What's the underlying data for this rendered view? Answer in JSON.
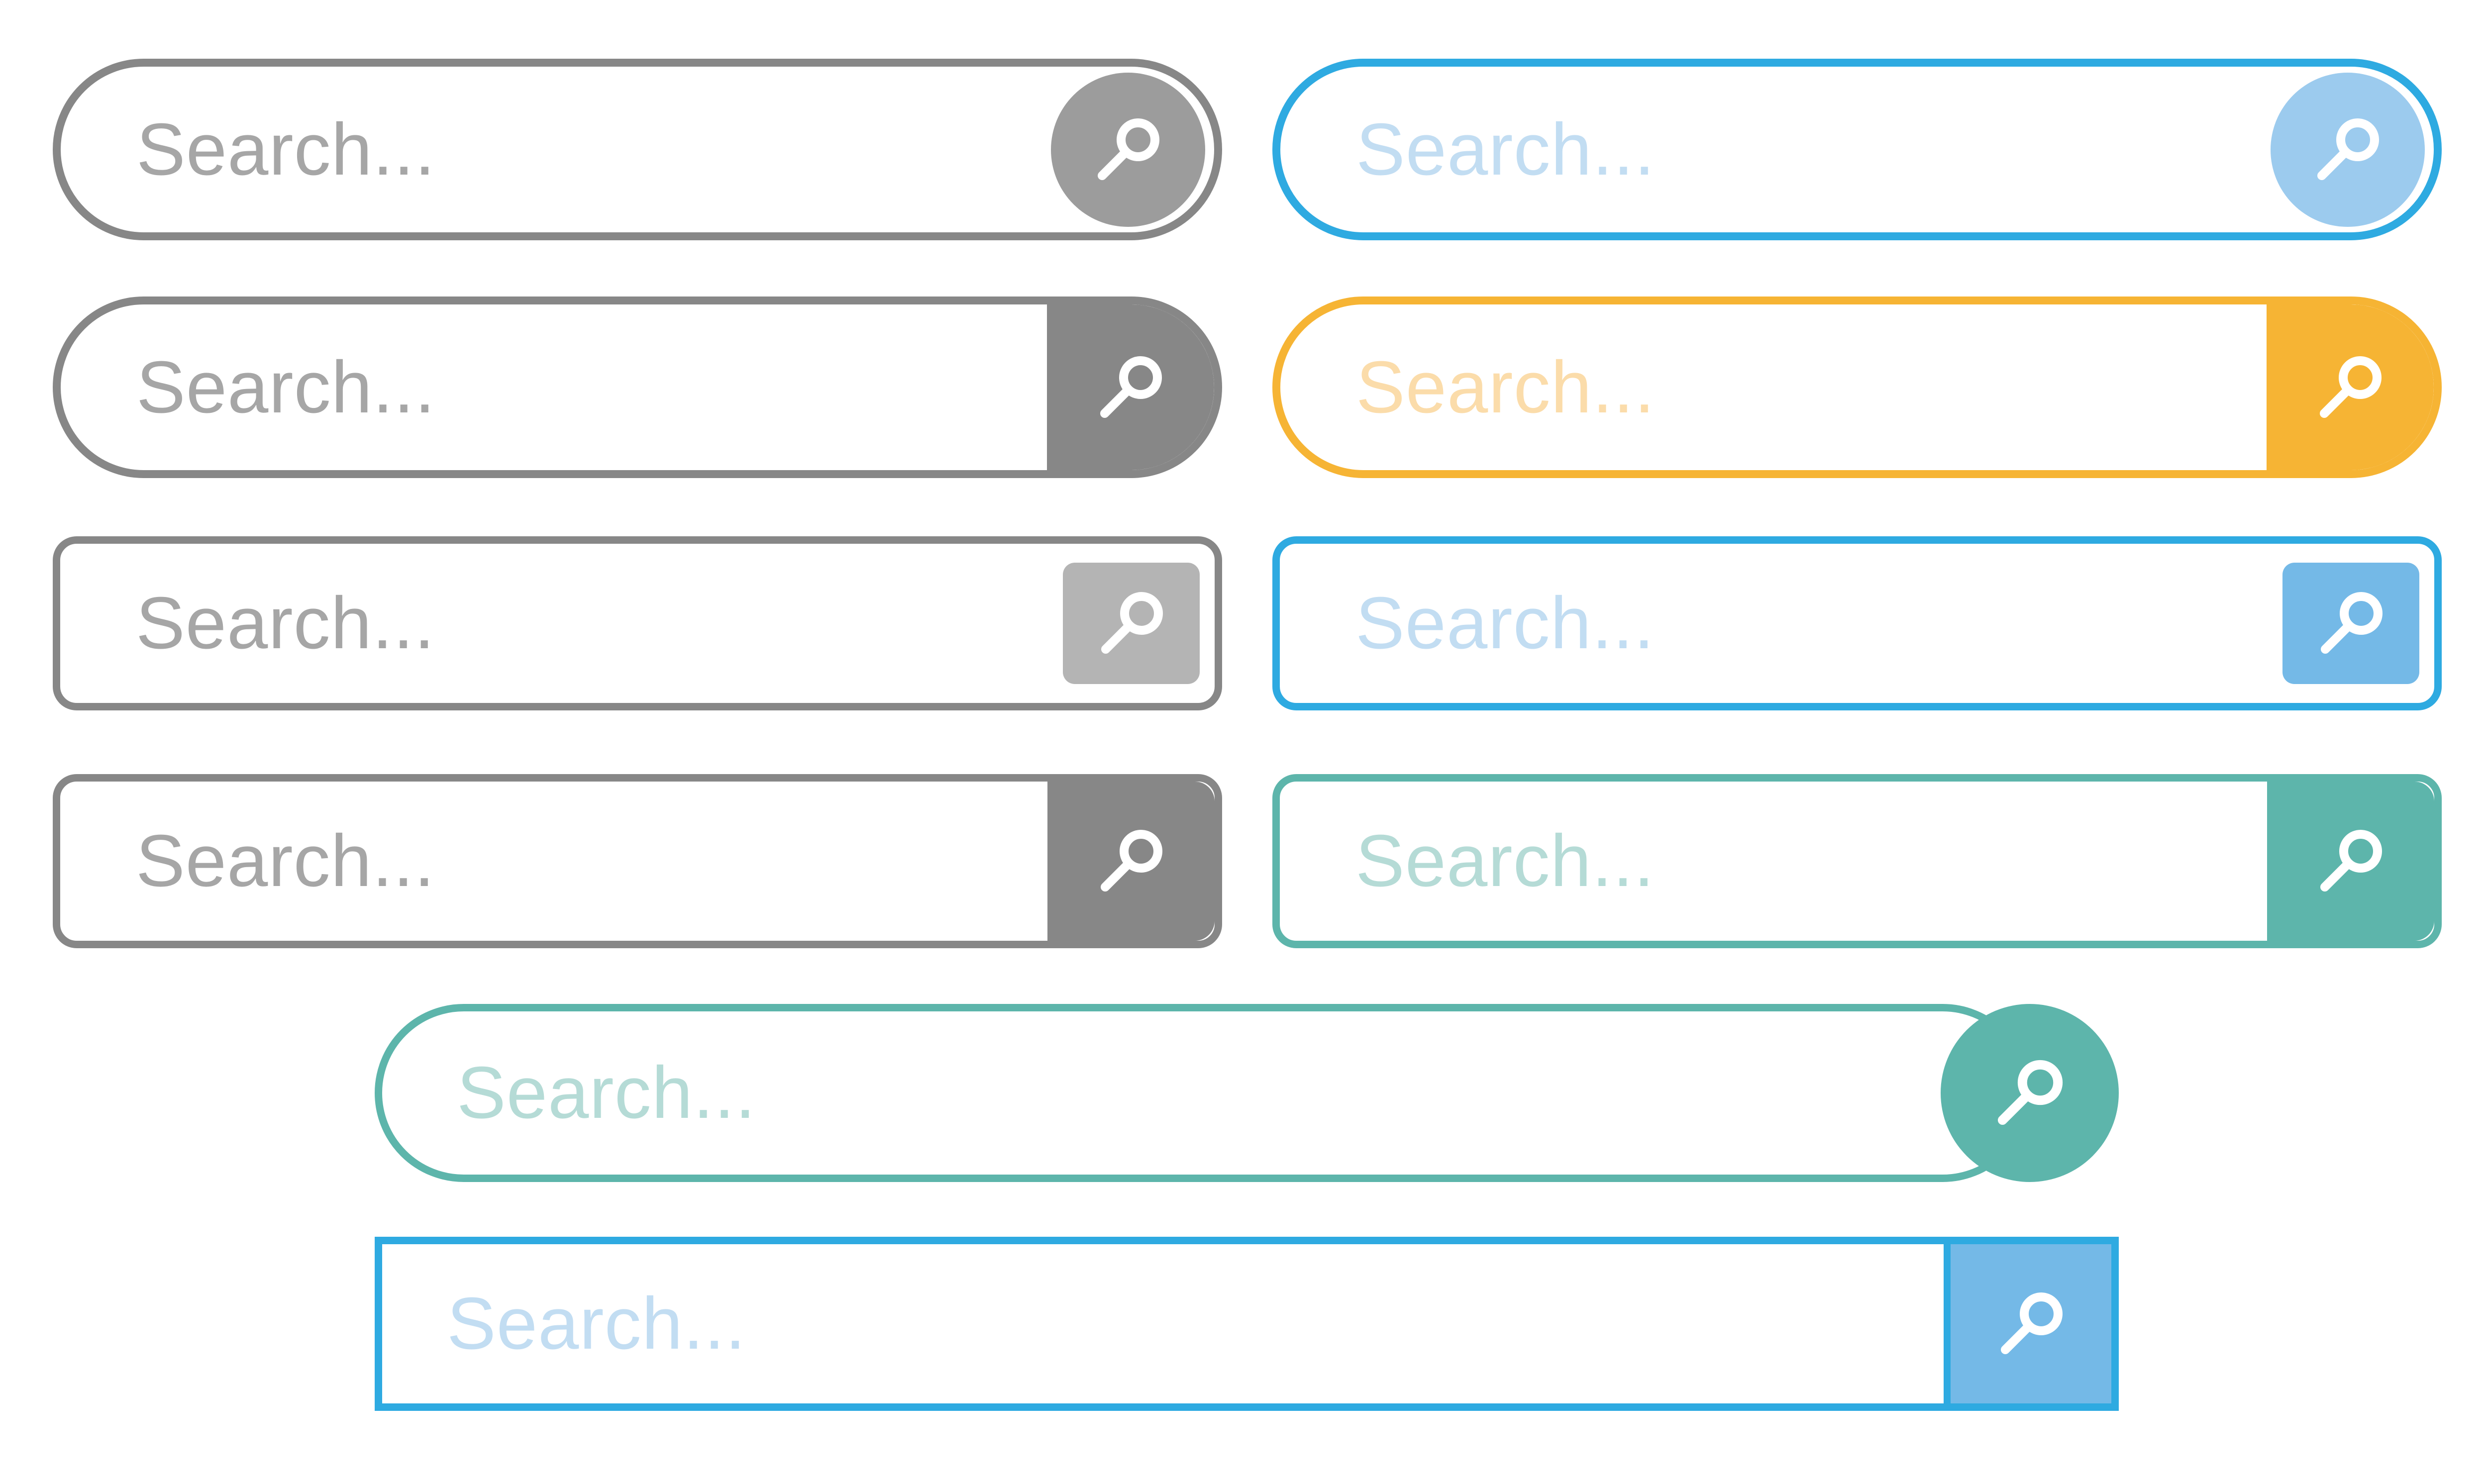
{
  "search_bars": [
    {
      "placeholder": "Search...",
      "style": "pill-inset-circle",
      "border_color": "#878787",
      "button_color": "#9c9c9c",
      "placeholder_color": "#a6a6a6"
    },
    {
      "placeholder": "Search...",
      "style": "pill-inset-circle",
      "border_color": "#2eaae1",
      "button_color": "#9ccbee",
      "placeholder_color": "#c2ddf2"
    },
    {
      "placeholder": "Search...",
      "style": "pill-segment",
      "border_color": "#878787",
      "button_color": "#878787",
      "placeholder_color": "#a6a6a6"
    },
    {
      "placeholder": "Search...",
      "style": "pill-segment",
      "border_color": "#f6b434",
      "button_color": "#f6b434",
      "placeholder_color": "#fbdcaa"
    },
    {
      "placeholder": "Search...",
      "style": "rounded-inset-square",
      "border_color": "#878787",
      "button_color": "#b4b4b4",
      "placeholder_color": "#a6a6a6"
    },
    {
      "placeholder": "Search...",
      "style": "rounded-inset-square",
      "border_color": "#2eaae1",
      "button_color": "#74b9e7",
      "placeholder_color": "#c2ddf2"
    },
    {
      "placeholder": "Search...",
      "style": "rounded-segment",
      "border_color": "#878787",
      "button_color": "#878787",
      "placeholder_color": "#a6a6a6"
    },
    {
      "placeholder": "Search...",
      "style": "rounded-segment",
      "border_color": "#5db5ab",
      "button_color": "#5db5ab",
      "placeholder_color": "#b5dbd6"
    },
    {
      "placeholder": "Search...",
      "style": "pill-end-circle",
      "border_color": "#5db5ab",
      "button_color": "#5db5ab",
      "placeholder_color": "#b5dbd6"
    },
    {
      "placeholder": "Search...",
      "style": "square-segment",
      "border_color": "#2eaae1",
      "button_color": "#74b9e7",
      "placeholder_color": "#c2ddf2"
    }
  ],
  "icons": {
    "search": "magnifier-icon"
  }
}
